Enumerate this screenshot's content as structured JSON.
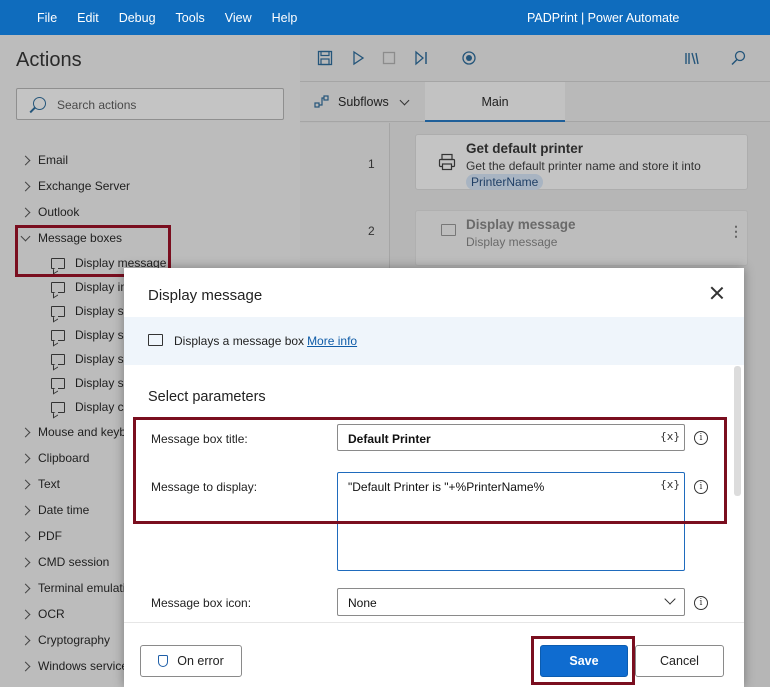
{
  "titlebar": {
    "menu": [
      "File",
      "Edit",
      "Debug",
      "Tools",
      "View",
      "Help"
    ],
    "app_title": "PADPrint | Power Automate"
  },
  "actions_pane": {
    "title": "Actions",
    "search_placeholder": "Search actions",
    "categories_top": [
      "Email",
      "Exchange Server",
      "Outlook"
    ],
    "expanded_category": "Message boxes",
    "sub_items": [
      "Display message",
      "Display in",
      "Display se",
      "Display se",
      "Display se",
      "Display se",
      "Display cu"
    ],
    "categories_bottom": [
      "Mouse and keyb",
      "Clipboard",
      "Text",
      "Date time",
      "PDF",
      "CMD session",
      "Terminal emulati",
      "OCR",
      "Cryptography",
      "Windows service"
    ]
  },
  "designer": {
    "subflows_label": "Subflows",
    "main_tab": "Main",
    "steps": [
      {
        "num": "1",
        "title": "Get default printer",
        "desc": "Get the default printer name and store it into",
        "var": "PrinterName"
      },
      {
        "num": "2",
        "title": "Display message",
        "desc": "Display message"
      }
    ]
  },
  "dialog": {
    "title": "Display message",
    "info_text": "Displays a message box",
    "more_info": "More info",
    "section_title": "Select parameters",
    "params": {
      "title_label": "Message box title:",
      "title_value": "Default Printer",
      "message_label": "Message to display:",
      "message_value": "\"Default Printer is \"+%PrinterName%",
      "icon_label": "Message box icon:",
      "icon_value": "None"
    },
    "var_token": "{x}",
    "info_glyph": "i",
    "buttons": {
      "on_error": "On error",
      "save": "Save",
      "cancel": "Cancel"
    }
  },
  "colors": {
    "accent": "#0f6cbd",
    "highlight": "#7a0e1f",
    "save": "#0f6cd0"
  }
}
